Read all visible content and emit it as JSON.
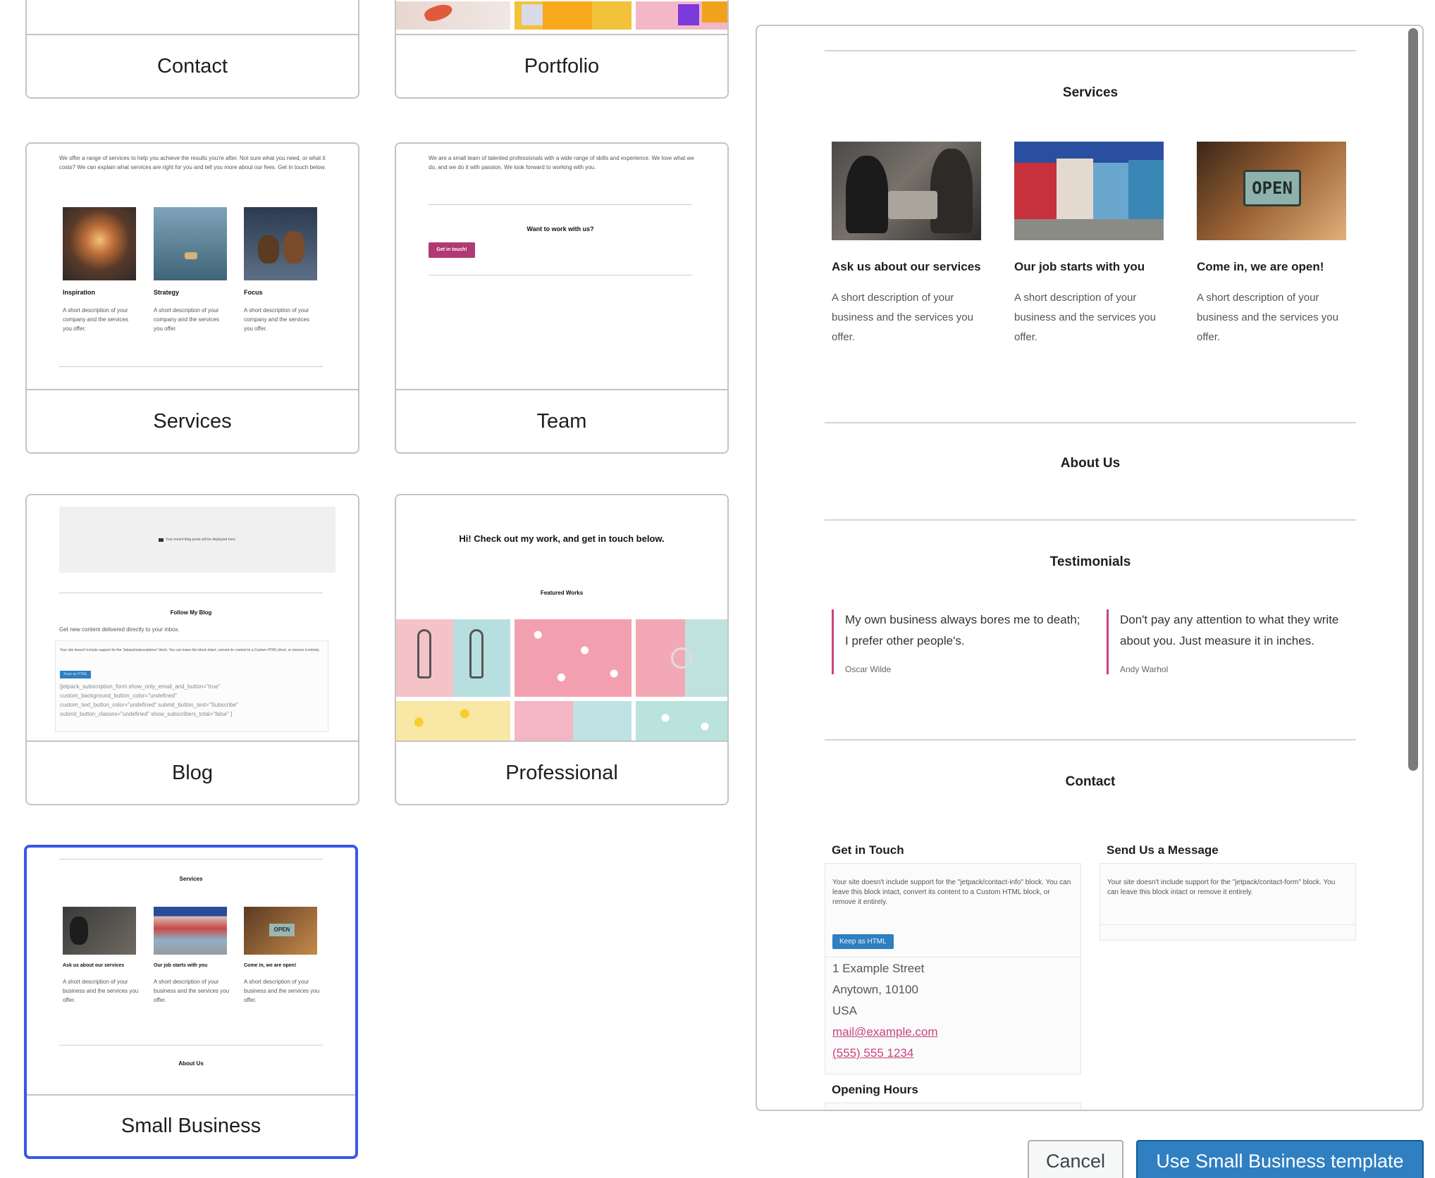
{
  "cards": [
    {
      "id": "contact",
      "label": "Contact"
    },
    {
      "id": "portfolio",
      "label": "Portfolio"
    },
    {
      "id": "services",
      "label": "Services",
      "intro": "We offer a range of services to help you achieve the results you're after. Not sure what you need, or what it costs? We can explain what services are right for you and tell you more about our fees. Get in touch below.",
      "items": [
        {
          "title": "Inspiration",
          "desc": "A short description of your company and the services you offer."
        },
        {
          "title": "Strategy",
          "desc": "A short description of your company and the services you offer."
        },
        {
          "title": "Focus",
          "desc": "A short description of your company and the services you offer."
        }
      ]
    },
    {
      "id": "team",
      "label": "Team",
      "intro": "We are a small team of talented professionals with a wide range of skills and experience. We love what we do, and we do it with passion. We look forward to working with you.",
      "cta_heading": "Want to work with us?",
      "cta_button": "Get in touch!"
    },
    {
      "id": "blog",
      "label": "Blog",
      "posts_notice": "Your recent blog posts will be displayed here.",
      "follow_heading": "Follow My Blog",
      "follow_text": "Get new content delivered directly to your inbox.",
      "support_notice": "Your site doesn't include support for the \"jetpack/subscriptions\" block. You can leave this block intact, convert its content to a Custom HTML block, or remove it entirely.",
      "keep_button": "Keep as HTML",
      "shortcode": "[jetpack_subscription_form show_only_email_and_button=\"true\" custom_background_button_color=\"undefined\" custom_text_button_color=\"undefined\" submit_button_text=\"Subscribe\" submit_button_classes=\"undefined\" show_subscribers_total=\"false\" ]"
    },
    {
      "id": "professional",
      "label": "Professional",
      "heading": "Hi! Check out my work, and get in touch below.",
      "subheading": "Featured Works"
    },
    {
      "id": "small-business",
      "label": "Small Business",
      "services_heading": "Services",
      "about_heading": "About Us",
      "items": [
        {
          "title": "Ask us about our services",
          "desc": "A short description of your business and the services you offer."
        },
        {
          "title": "Our job starts with you",
          "desc": "A short description of your business and the services you offer."
        },
        {
          "title": "Come in, we are open!",
          "desc": "A short description of your business and the services you offer."
        }
      ]
    }
  ],
  "preview": {
    "services_heading": "Services",
    "items": [
      {
        "title": "Ask us about our services",
        "desc": "A short description of your business and the services you offer."
      },
      {
        "title": "Our job starts with you",
        "desc": "A short description of your business and the services you offer."
      },
      {
        "title": "Come in, we are open!",
        "desc": "A short description of your business and the services you offer."
      }
    ],
    "open_sign": "OPEN",
    "about_heading": "About Us",
    "testimonials_heading": "Testimonials",
    "testimonials": [
      {
        "quote": "My own business always bores me to death; I prefer other people's.",
        "cite": "Oscar Wilde"
      },
      {
        "quote": "Don't pay any attention to what they write about you. Just measure it in inches.",
        "cite": "Andy Warhol"
      }
    ],
    "contact_heading": "Contact",
    "get_in_touch": "Get in Touch",
    "send_message": "Send Us a Message",
    "contact_info_notice": "Your site doesn't include support for the \"jetpack/contact-info\" block. You can leave this block intact, convert its content to a Custom HTML block, or remove it entirely.",
    "contact_form_notice": "Your site doesn't include support for the \"jetpack/contact-form\" block. You can leave this block intact or remove it entirely.",
    "keep_button": "Keep as HTML",
    "address_line1": "1 Example Street",
    "address_line2": "Anytown, 10100",
    "address_line3": "USA",
    "email": "mail@example.com",
    "phone": "(555) 555 1234",
    "opening_hours": "Opening Hours"
  },
  "buttons": {
    "cancel": "Cancel",
    "use": "Use Small Business template"
  },
  "colors": {
    "accent": "#3858e9",
    "primary_button": "#2f7fc1",
    "link": "#c9437e",
    "border": "#c3c4c7"
  }
}
